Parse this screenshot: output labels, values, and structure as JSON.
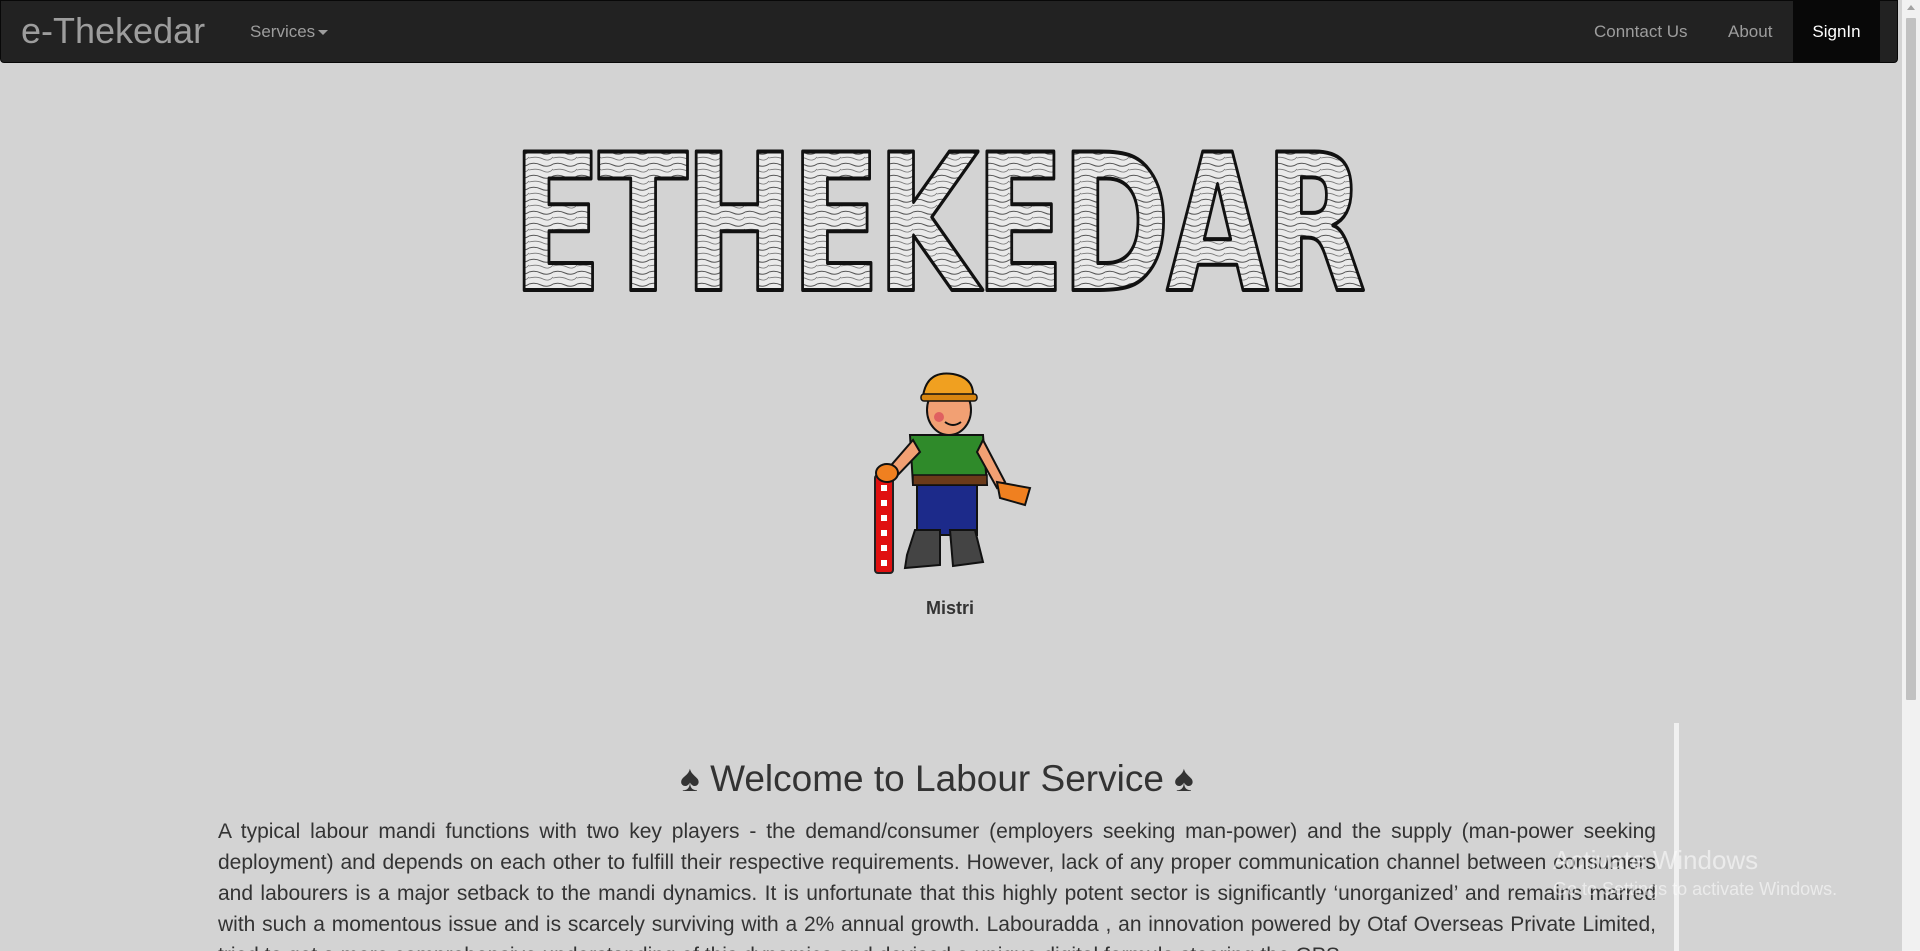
{
  "navbar": {
    "brand": "e-Thekedar",
    "services_label": "Services",
    "contact_label": "Conntact Us",
    "about_label": "About",
    "signin_label": "SignIn"
  },
  "logo": {
    "text": "ETHEKEDAR"
  },
  "worker": {
    "caption": "Mistri"
  },
  "main": {
    "welcome_title": "♠ Welcome to Labour Service ♠",
    "intro_paragraph": "A typical labour mandi functions with two key players - the demand/consumer (employers seeking man-power) and the supply (man-power seeking deployment) and depends on each other to fulfill their respective requirements. However, lack of any proper communication channel between consumers and labourers is a major setback to the mandi dynamics. It is unfortunate that this highly potent sector is significantly ‘unorganized’ and remains marred with such a momentous issue and is scarcely surviving with a 2% annual growth. Labouradda , an innovation powered by Otaf Overseas Private Limited, tried to get a more comprehensive understanding of this dynamics and devised a unique digital formula steering the GPS"
  },
  "watermark": {
    "title": "Activate Windows",
    "subtitle": "Go to Settings to activate Windows."
  },
  "colors": {
    "navbar_bg": "#222222",
    "page_bg": "#d3d3d3",
    "nav_text": "#9d9d9d",
    "signin_bg": "#080808"
  }
}
